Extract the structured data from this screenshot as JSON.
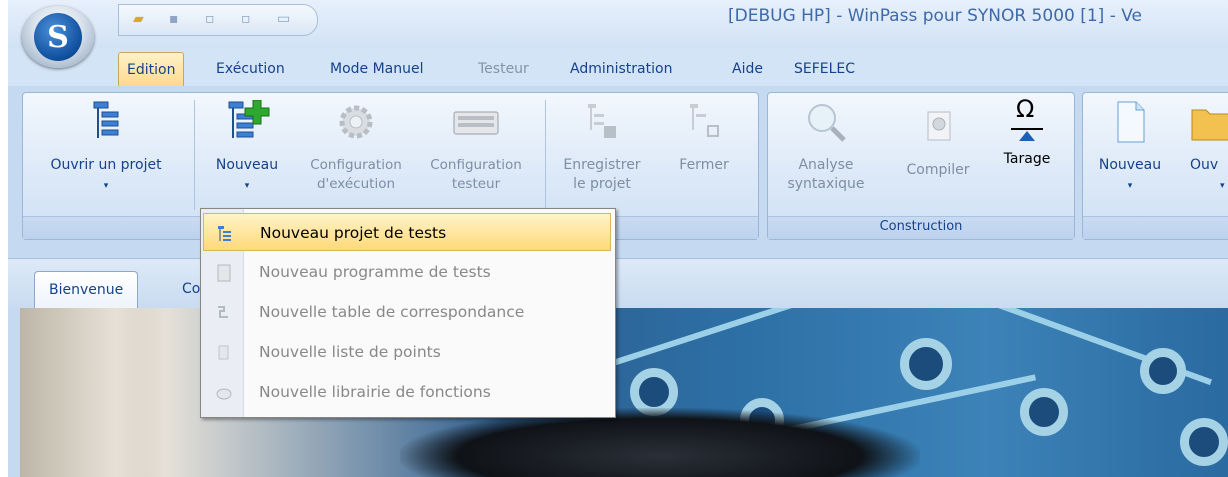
{
  "window": {
    "title": "[DEBUG HP] - WinPass pour SYNOR 5000 [1] - Ve",
    "logo_letter": "S"
  },
  "menubar": {
    "items": [
      "Edition",
      "Exécution",
      "Mode Manuel",
      "Testeur",
      "Administration",
      "Aide",
      "SEFELEC"
    ],
    "active": "Edition"
  },
  "ribbon": {
    "open_project": "Ouvrir un projet",
    "new": "Nouveau",
    "exec_config_l1": "Configuration",
    "exec_config_l2": "d'exécution",
    "tester_config_l1": "Configuration",
    "tester_config_l2": "testeur",
    "save_project_l1": "Enregistrer",
    "save_project_l2": "le projet",
    "close": "Fermer",
    "syntax_l1": "Analyse",
    "syntax_l2": "syntaxique",
    "compile": "Compiler",
    "tarage": "Tarage",
    "new2": "Nouveau",
    "open2": "Ouv",
    "group_construction": "Construction",
    "drop_arrow": "▾",
    "tarage_symbol": "Ω"
  },
  "tabs": {
    "welcome": "Bienvenue",
    "second_partial": "Co"
  },
  "dropdown": {
    "items": [
      {
        "label": "Nouveau projet de tests",
        "enabled": true,
        "highlighted": true
      },
      {
        "label": "Nouveau programme de tests",
        "enabled": false
      },
      {
        "label": "Nouvelle table de correspondance",
        "enabled": false
      },
      {
        "label": "Nouvelle liste de points",
        "enabled": false
      },
      {
        "label": "Nouvelle librairie de fonctions",
        "enabled": false
      }
    ]
  },
  "colors": {
    "ribbon_text": "#15428b",
    "highlight": "#ffd97a",
    "menubar_bg": "#d4e4f7"
  }
}
